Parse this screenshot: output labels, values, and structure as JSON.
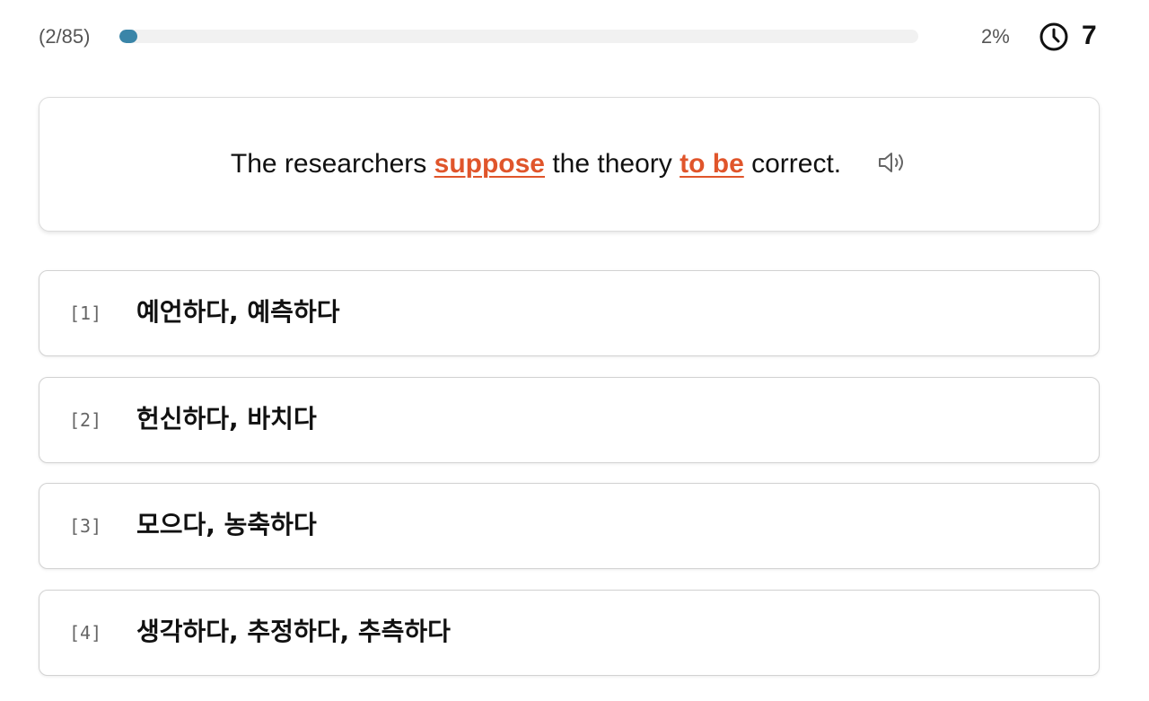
{
  "header": {
    "counter": "(2/85)",
    "progress": 0.02,
    "percent": "2%",
    "timer_icon": "clock-icon",
    "timer": "7"
  },
  "question": {
    "part1": "The researchers ",
    "highlight1": "suppose",
    "part2": " the theory ",
    "highlight2": "to be",
    "part3": " correct.",
    "audio_icon": "speaker-icon",
    "highlight_color": "#e0552b"
  },
  "options": [
    {
      "number": "[1]",
      "text": "예언하다, 예측하다"
    },
    {
      "number": "[2]",
      "text": "헌신하다, 바치다"
    },
    {
      "number": "[3]",
      "text": "모으다, 농축하다"
    },
    {
      "number": "[4]",
      "text": "생각하다, 추정하다, 추측하다"
    }
  ],
  "colors": {
    "progress_fill": "#3a85a8",
    "progress_track": "#f1f1f1"
  }
}
